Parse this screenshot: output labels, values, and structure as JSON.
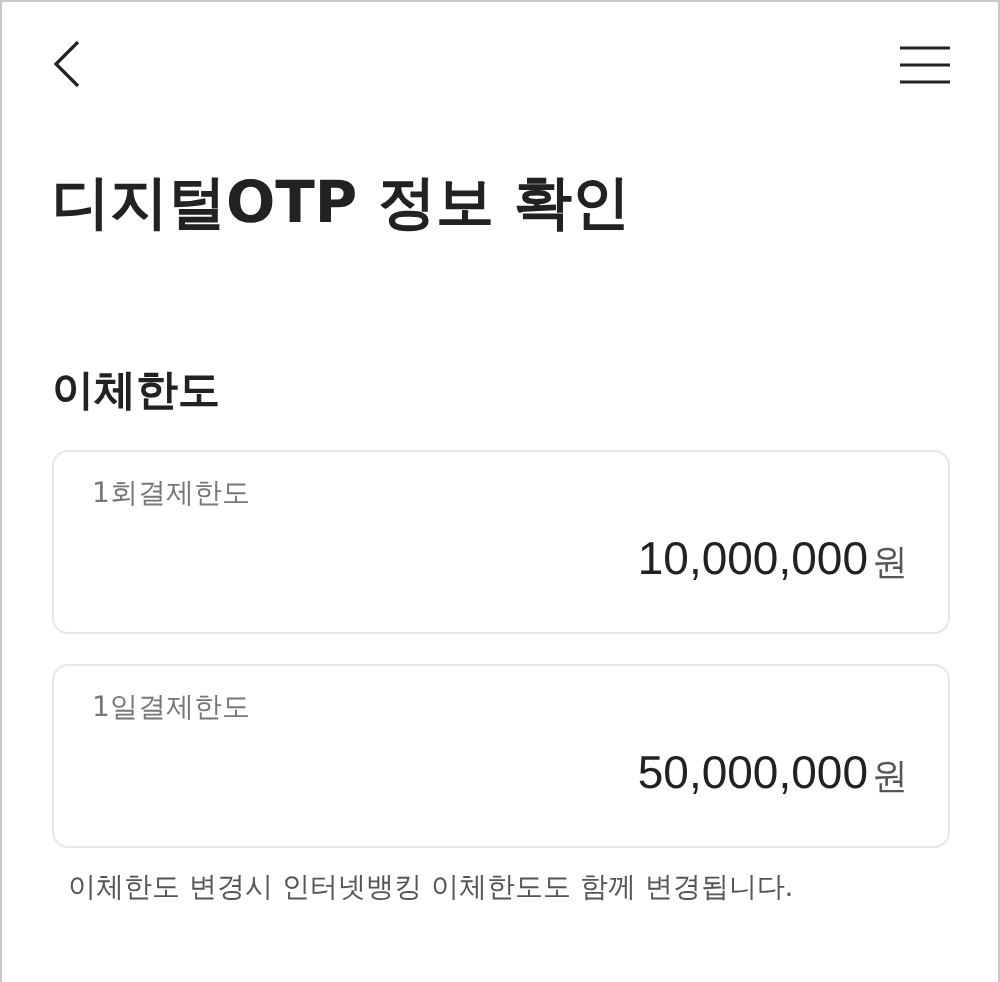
{
  "page_title": "디지털OTP 정보 확인",
  "section": {
    "title": "이체한도",
    "limits": [
      {
        "label": "1회결제한도",
        "amount": "10,000,000",
        "unit": "원"
      },
      {
        "label": "1일결제한도",
        "amount": "50,000,000",
        "unit": "원"
      }
    ],
    "note": "이체한도 변경시 인터넷뱅킹 이체한도도 함께 변경됩니다."
  }
}
